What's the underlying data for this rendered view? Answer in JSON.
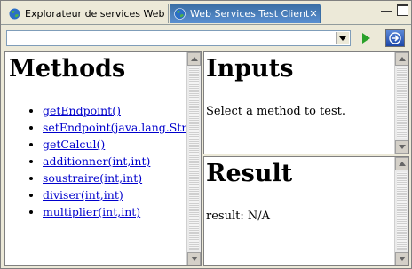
{
  "tabs": [
    {
      "label": "Explorateur de services Web",
      "active": false
    },
    {
      "label": "Web Services Test Client",
      "active": true
    }
  ],
  "address": {
    "value": "",
    "placeholder": ""
  },
  "methods": {
    "title": "Methods",
    "items": [
      "getEndpoint()",
      "setEndpoint(java.lang.String)",
      "getCalcul()",
      "additionner(int,int)",
      "soustraire(int,int)",
      "diviser(int,int)",
      "multiplier(int,int)"
    ]
  },
  "inputs": {
    "title": "Inputs",
    "message": "Select a method to test."
  },
  "result": {
    "title": "Result",
    "message": "result: N/A"
  },
  "colors": {
    "active_tab": "#3a6ea5",
    "link": "#0000cc",
    "go_arrow": "#2aa12a"
  }
}
